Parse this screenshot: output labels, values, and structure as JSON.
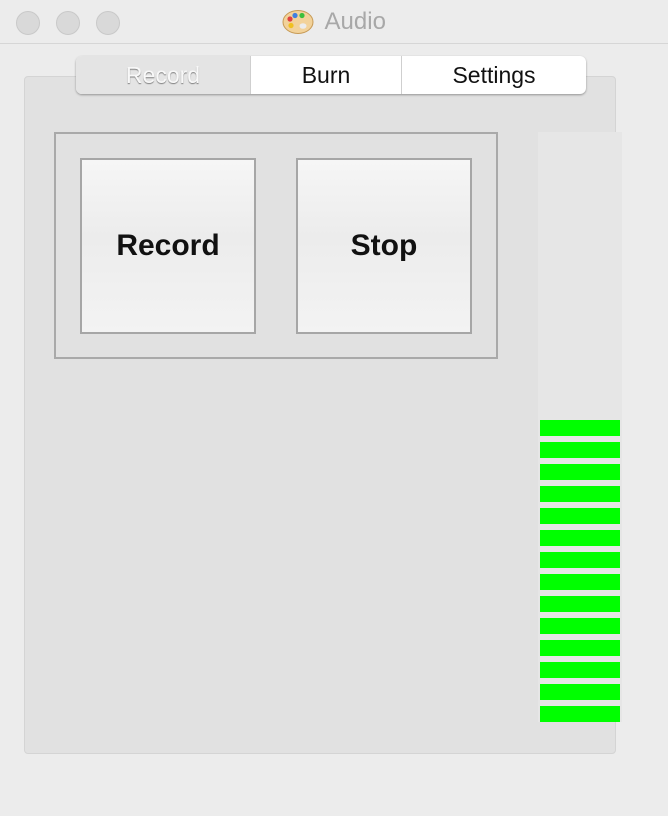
{
  "window": {
    "title": "Audio",
    "app_icon": "palette-icon"
  },
  "tabs": [
    {
      "label": "Record",
      "selected": true
    },
    {
      "label": "Burn",
      "selected": false
    },
    {
      "label": "Settings",
      "selected": false
    }
  ],
  "buttons": {
    "record_label": "Record",
    "stop_label": "Stop"
  },
  "level_meter": {
    "total_segments": 27,
    "lit_segments": 14,
    "lit_color": "#00ff00"
  }
}
